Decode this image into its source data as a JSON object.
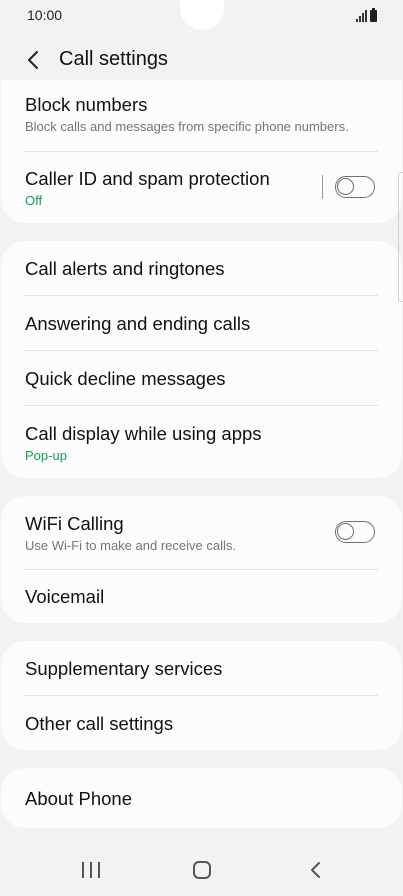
{
  "status_bar": {
    "time": "10:00"
  },
  "header": {
    "title": "Call settings"
  },
  "card1": {
    "block_numbers": {
      "title": "Block numbers",
      "subtitle": "Block calls and messages from specific phone numbers."
    },
    "caller_id": {
      "title": "Caller ID and spam protection",
      "subtitle": "Off",
      "toggle_on": false
    }
  },
  "card2": {
    "call_alerts": {
      "title": "Call alerts and ringtones"
    },
    "answering": {
      "title": "Answering and ending calls"
    },
    "quick_decline": {
      "title": "Quick decline messages"
    },
    "call_display": {
      "title": "Call display while using apps",
      "subtitle": "Pop-up"
    }
  },
  "card3": {
    "wifi_calling": {
      "title": "WiFi Calling",
      "subtitle": "Use Wi-Fi to make and receive calls.",
      "toggle_on": false
    },
    "voicemail": {
      "title": "Voicemail"
    }
  },
  "card4": {
    "supplementary": {
      "title": "Supplementary services"
    },
    "other": {
      "title": "Other call settings"
    }
  },
  "card5": {
    "about": {
      "title": "About Phone"
    }
  },
  "colors": {
    "accent_green": "#1a9b5a",
    "background": "#f2f2f2",
    "card": "#fcfcfc"
  },
  "icons": [
    "back-icon",
    "signal-icon",
    "battery-icon",
    "recent-apps-icon",
    "home-icon",
    "nav-back-icon"
  ]
}
